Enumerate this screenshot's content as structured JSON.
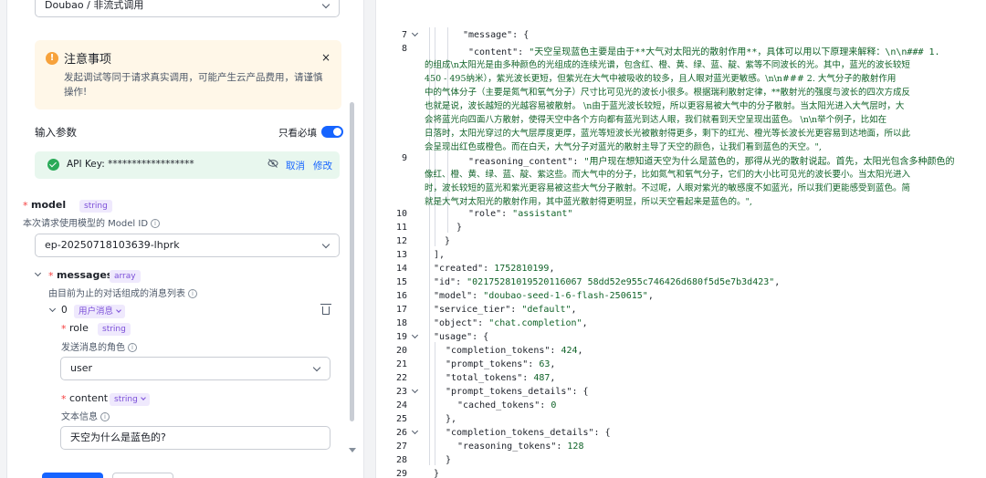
{
  "form": {
    "call_mode": "Doubao / 非流式调用",
    "warning": {
      "title": "注意事项",
      "close": "×",
      "text": "发起调试等同于请求真实调用，可能产生云产品费用，请谨慎操作!"
    },
    "params_title": "输入参数",
    "required_only_label": "只看必填",
    "required_only_on": true,
    "api_key": {
      "label": "API Key:  ******************",
      "cancel": "取消",
      "edit": "修改"
    },
    "model": {
      "required": "*",
      "name": "model",
      "type": "string",
      "desc": "本次请求使用模型的 Model ID",
      "value": "ep-20250718103639-lhprk"
    },
    "messages": {
      "required": "*",
      "name": "messages",
      "type": "array",
      "desc": "由目前为止的对话组成的消息列表",
      "item_index": "0",
      "item_tag": "用户消息",
      "role": {
        "required": "*",
        "name": "role",
        "type": "string",
        "desc": "发送消息的角色",
        "value": "user"
      },
      "content": {
        "required": "*",
        "name": "content",
        "type": "string",
        "desc": "文本信息",
        "value": "天空为什么是蓝色的?"
      }
    },
    "info_glyph": "i",
    "warn_glyph": "!"
  },
  "code": {
    "line_numbers": [
      "7",
      "8",
      "9",
      "10",
      "11",
      "12",
      "13",
      "14",
      "15",
      "16",
      "17",
      "18",
      "19",
      "20",
      "21",
      "22",
      "23",
      "24",
      "25",
      "26",
      "27",
      "28",
      "29"
    ],
    "line7": "\"message\": {",
    "line8_key": "\"content\":",
    "line8_val": " \"天空呈现蓝色主要是由于**大气对太阳光的散射作用**，具体可以用以下原理来解释：\\n\\n### 1.",
    "line8_wrap": [
      "的组成\\n太阳光是由多种颜色的光组成的连续光谱，包含红、橙、黄、绿、蓝、靛、紫等不同波长的光。其中，蓝光的波长较短",
      "450 - 495纳米），紫光波长更短，但紫光在大气中被吸收的较多，且人眼对蓝光更敏感。\\n\\n### 2. 大气分子的散射作用",
      "中的气体分子（主要是氮气和氧气分子）尺寸比可见光的波长小很多。根据瑞利散射定律，**散射光的强度与波长的四次方成反",
      "也就是说，波长越短的光越容易被散射。  \\n由于蓝光波长较短，所以更容易被大气中的分子散射。当太阳光进入大气层时，大",
      "会将蓝光向四面八方散射，使得天空中各个方向都有蓝光到达人眼，我们就看到天空呈现出蓝色。  \\n\\n举个例子，比如在",
      "日落时，太阳光穿过的大气层厚度更厚，蓝光等短波长光被散射得更多，剩下的红光、橙光等长波长光更容易到达地面，所以此",
      "会呈现出红色或橙色。而在白天，大气分子对蓝光的散射主导了天空的颜色，让我们看到蓝色的天空。\","
    ],
    "line9_key": "\"reasoning_content\":",
    "line9_val": " \"用户现在想知道天空为什么是蓝色的，那得从光的散射说起。首先，太阳光包含多种颜色的",
    "line9_wrap": [
      "像红、橙、黄、绿、蓝、靛、紫这些。而大气中的分子，比如氮气和氧气分子，它们的大小比可见光的波长要小。当太阳光进入",
      "时，波长较短的蓝光和紫光更容易被这些大气分子散射。不过呢，人眼对紫光的敏感度不如蓝光，所以我们更能感受到蓝色。简",
      "就是大气对太阳光的散射作用，其中蓝光散射得更明显，所以天空看起来是蓝色的。\","
    ],
    "line10_key": "\"role\":",
    "line10_val": " \"assistant\"",
    "line11": "}",
    "line12": "}",
    "line13": "],",
    "line14_key": "\"created\":",
    "line14_val": " 1752810199",
    "line15_key": "\"id\":",
    "line15_val": " \"02175281019520116067 58dd52e955c746426d680f5d5e7b3d423\"",
    "line16_key": "\"model\":",
    "line16_val": " \"doubao-seed-1-6-flash-250615\"",
    "line17_key": "\"service_tier\":",
    "line17_val": " \"default\"",
    "line18_key": "\"object\":",
    "line18_val": " \"chat.completion\"",
    "line19": "\"usage\": {",
    "line20_key": "\"completion_tokens\":",
    "line20_val": " 424",
    "line21_key": "\"prompt_tokens\":",
    "line21_val": " 63",
    "line22_key": "\"total_tokens\":",
    "line22_val": " 487",
    "line23": "\"prompt_tokens_details\": {",
    "line24_key": "\"cached_tokens\":",
    "line24_val": " 0",
    "line25": "},",
    "line26": "\"completion_tokens_details\": {",
    "line27_key": "\"reasoning_tokens\":",
    "line27_val": " 128",
    "line28": "}",
    "line29": "}"
  }
}
